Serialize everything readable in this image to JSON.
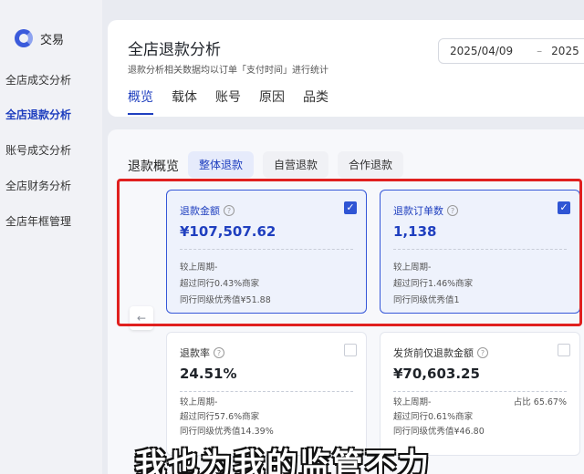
{
  "sidebar": {
    "brand": "交易",
    "items": [
      {
        "label": "全店成交分析"
      },
      {
        "label": "全店退款分析"
      },
      {
        "label": "账号成交分析"
      },
      {
        "label": "全店财务分析"
      },
      {
        "label": "全店年框管理"
      }
    ]
  },
  "header": {
    "title": "全店退款分析",
    "subtitle": "退款分析相关数据均以订单「支付时间」进行统计",
    "date_start": "2025/04/09",
    "date_sep": "–",
    "date_end": "2025",
    "tabs": [
      {
        "label": "概览"
      },
      {
        "label": "载体"
      },
      {
        "label": "账号"
      },
      {
        "label": "原因"
      },
      {
        "label": "品类"
      }
    ]
  },
  "overview": {
    "title": "退款概览",
    "sub_tabs": [
      {
        "label": "整体退款"
      },
      {
        "label": "自营退款"
      },
      {
        "label": "合作退款"
      }
    ],
    "arrow": "←",
    "metrics": [
      {
        "label": "退款金额",
        "value": "¥107,507.62",
        "compare": "较上周期-",
        "peer": "超过同行0.43%商家",
        "best": "同行同级优秀值¥51.88",
        "checked": true
      },
      {
        "label": "退款订单数",
        "value": "1,138",
        "compare": "较上周期-",
        "peer": "超过同行1.46%商家",
        "best": "同行同级优秀值1",
        "checked": true
      },
      {
        "label": "退款率",
        "value": "24.51%",
        "compare": "较上周期-",
        "peer": "超过同行57.6%商家",
        "best": "同行同级优秀值14.39%",
        "checked": false
      },
      {
        "label": "发货前仅退款金额",
        "value": "¥70,603.25",
        "compare": "较上周期-",
        "share": "占比 65.67%",
        "peer": "超过同行0.61%商家",
        "best": "同行同级优秀值¥46.80",
        "checked": false
      }
    ]
  },
  "caption": "我也为我的监管不力",
  "colors": {
    "accent": "#1f3fbf",
    "highlight": "#e0201f"
  }
}
